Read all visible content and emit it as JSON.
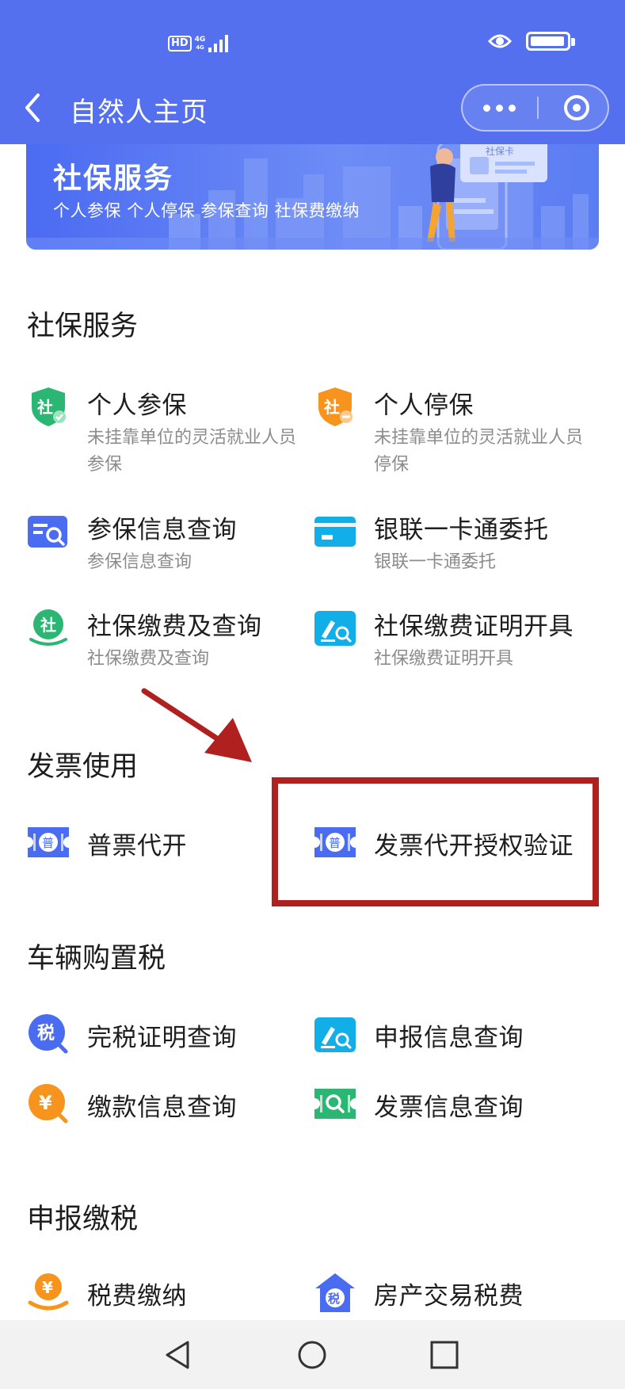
{
  "status_bar": {
    "hd": "HD",
    "network": "4G",
    "network_sub": "4G"
  },
  "header": {
    "title": "自然人主页",
    "back_icon": "back-arrow-icon",
    "more_icon": "more-dots-icon",
    "close_icon": "mini-program-close-icon"
  },
  "banner": {
    "title": "社保服务",
    "subtitle": "个人参保 个人停保 参保查询 社保费缴纳",
    "card_text": "社保卡"
  },
  "sections": [
    {
      "title": "社保服务",
      "items": [
        {
          "title": "个人参保",
          "desc": "未挂靠单位的灵活就业人员参保",
          "icon": "shield-social-green-icon"
        },
        {
          "title": "个人停保",
          "desc": "未挂靠单位的灵活就业人员停保",
          "icon": "shield-social-orange-icon"
        },
        {
          "title": "参保信息查询",
          "desc": "参保信息查询",
          "icon": "list-search-icon"
        },
        {
          "title": "银联一卡通委托",
          "desc": "银联一卡通委托",
          "icon": "bank-card-icon"
        },
        {
          "title": "社保缴费及查询",
          "desc": "社保缴费及查询",
          "icon": "social-pay-icon"
        },
        {
          "title": "社保缴费证明开具",
          "desc": "社保缴费证明开具",
          "icon": "edit-search-icon"
        }
      ]
    },
    {
      "title": "发票使用",
      "items": [
        {
          "title": "普票代开",
          "icon": "ticket-icon",
          "glyph": "普"
        },
        {
          "title": "发票代开授权验证",
          "icon": "ticket-icon",
          "glyph": "普"
        }
      ]
    },
    {
      "title": "车辆购置税",
      "items": [
        {
          "title": "完税证明查询",
          "icon": "tax-search-icon",
          "glyph": "税"
        },
        {
          "title": "申报信息查询",
          "icon": "edit-search-icon"
        },
        {
          "title": "缴款信息查询",
          "icon": "yen-search-icon",
          "glyph": "¥"
        },
        {
          "title": "发票信息查询",
          "icon": "ticket-search-icon"
        }
      ]
    },
    {
      "title": "申报缴税",
      "items": [
        {
          "title": "税费缴纳",
          "icon": "yen-hand-icon",
          "glyph": "¥"
        },
        {
          "title": "房产交易税费",
          "icon": "house-tax-icon",
          "glyph": "税"
        }
      ]
    }
  ],
  "colors": {
    "header": "#5470ee",
    "accent_blue": "#4a6cf0",
    "green": "#2bb673",
    "orange": "#f7941d",
    "cyan": "#12aee8",
    "annotation_red": "#b0201e"
  },
  "nav": {
    "back_icon": "triangle-back-icon",
    "home_icon": "circle-home-icon",
    "recent_icon": "square-recent-icon"
  }
}
